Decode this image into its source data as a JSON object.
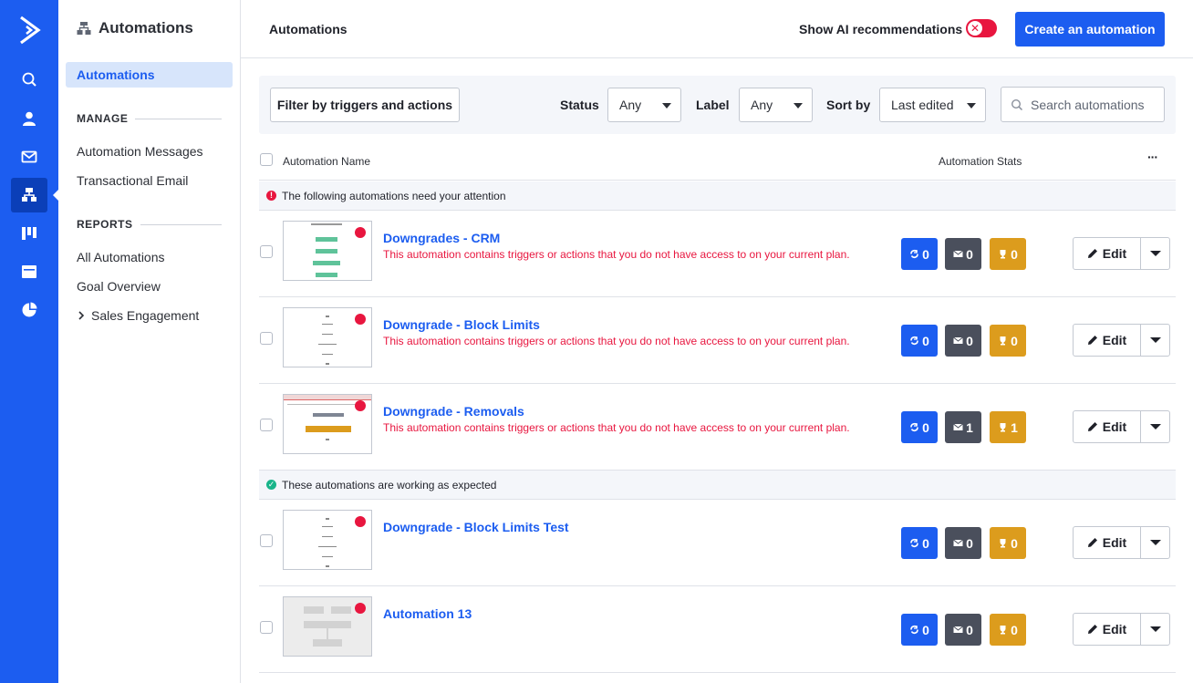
{
  "sidebar": {
    "title": "Automations",
    "active_item": "Automations",
    "manage_header": "MANAGE",
    "manage_items": [
      "Automation Messages",
      "Transactional Email"
    ],
    "reports_header": "REPORTS",
    "reports_items": [
      "All Automations",
      "Goal Overview",
      "Sales Engagement"
    ]
  },
  "topbar": {
    "title": "Automations",
    "ai_label": "Show AI recommendations",
    "ai_toggle_icon": "✕",
    "create_label": "Create an automation"
  },
  "filters": {
    "filter_button": "Filter by triggers and actions",
    "status_label": "Status",
    "status_value": "Any",
    "label_label": "Label",
    "label_value": "Any",
    "sort_label": "Sort by",
    "sort_value": "Last edited",
    "search_placeholder": "Search automations"
  },
  "table": {
    "col_name": "Automation Name",
    "col_stats": "Automation Stats",
    "more": "···",
    "group_attention": "The following automations need your attention",
    "group_ok": "These automations are working as expected",
    "edit_label": "Edit",
    "rows": [
      {
        "name": "Downgrades - CRM",
        "warning": "This automation contains triggers or actions that you do not have access to on your current plan.",
        "contacts": "0",
        "emails": "0",
        "goals": "0"
      },
      {
        "name": "Downgrade - Block Limits",
        "warning": "This automation contains triggers or actions that you do not have access to on your current plan.",
        "contacts": "0",
        "emails": "0",
        "goals": "0"
      },
      {
        "name": "Downgrade - Removals",
        "warning": "This automation contains triggers or actions that you do not have access to on your current plan.",
        "contacts": "0",
        "emails": "1",
        "goals": "1"
      },
      {
        "name": "Downgrade - Block Limits Test",
        "warning": "",
        "contacts": "0",
        "emails": "0",
        "goals": "0"
      },
      {
        "name": "Automation 13",
        "warning": "",
        "contacts": "0",
        "emails": "0",
        "goals": "0"
      }
    ]
  },
  "colors": {
    "brand": "#1c5df0",
    "danger": "#e8163f",
    "success": "#19b48a",
    "goal": "#dc9c1d",
    "email": "#4a4f5c"
  }
}
